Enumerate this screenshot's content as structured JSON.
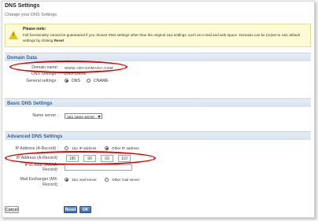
{
  "page": {
    "title": "DNS Settings",
    "subtitle": "Change your DNS Settings"
  },
  "note": {
    "title": "Please note:",
    "text_1": "Full functionality cannot be guaranteed if you choose DNS settings other than the original 1&1 settings, such as e-mail and web space. Domains can be (re)set to 1&1 default settings by clicking ",
    "text_bold": "Reset"
  },
  "domain_data": {
    "heading": "Domain Data",
    "domain_name_label": "Domain name:",
    "domain_name_value": "WWW.<MY-DOMAIN>.COM",
    "dns_settings_label": "DNS Settings :",
    "dns_settings_value": "DNS Check",
    "general_label": "General settings :",
    "option_dns": "DNS",
    "option_cname": "CNAME"
  },
  "basic_dns": {
    "heading": "Basic DNS Settings",
    "name_server_label": "Name server :",
    "name_server_value": "1&1 name server"
  },
  "advanced_dns": {
    "heading": "Advanced DNS Settings",
    "ip_label": "IP Address (A-Record) :",
    "option_11_ip": "1&1 IP address",
    "option_other_ip": "Other IP address",
    "ip_a_label": "IP Address (A-Record):",
    "ip_octets": [
      "180",
      "90",
      "69",
      "110"
    ],
    "ipv6_label_1": "IPv6 Addr. (AAAA-",
    "ipv6_label_2": "Record):",
    "mx_label_1": "Mail Exchanger (MX-",
    "mx_label_2": "Record):",
    "option_11_mail": "1&1 mail server",
    "option_other_mail": "Other mail server"
  },
  "buttons": {
    "cancel": "Cancel",
    "reset": "Reset",
    "ok": "OK"
  },
  "colors": {
    "section_text": "#3c5f8c",
    "highlight": "#d60000",
    "note_bg": "#fdfbd6",
    "button_blue": "#3f6aa3"
  }
}
